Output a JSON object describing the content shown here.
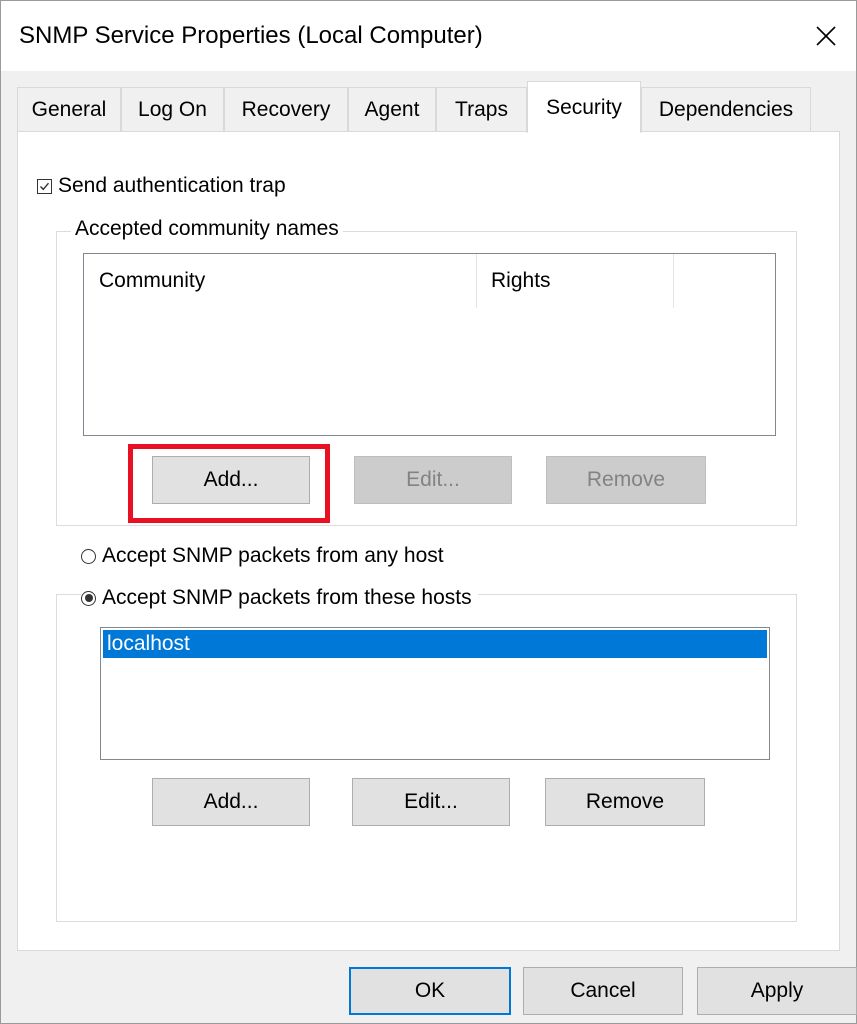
{
  "window": {
    "title": "SNMP Service Properties (Local Computer)"
  },
  "tabs": [
    {
      "label": "General",
      "active": false
    },
    {
      "label": "Log On",
      "active": false
    },
    {
      "label": "Recovery",
      "active": false
    },
    {
      "label": "Agent",
      "active": false
    },
    {
      "label": "Traps",
      "active": false
    },
    {
      "label": "Security",
      "active": true
    },
    {
      "label": "Dependencies",
      "active": false
    }
  ],
  "security": {
    "send_auth_trap": {
      "label": "Send authentication trap",
      "checked": true
    },
    "community_group": {
      "title": "Accepted community names",
      "columns": [
        "Community",
        "Rights"
      ],
      "rows": [],
      "add_label": "Add...",
      "edit_label": "Edit...",
      "remove_label": "Remove",
      "edit_enabled": false,
      "remove_enabled": false
    },
    "accept_any_host": {
      "label": "Accept SNMP packets from any host",
      "selected": false
    },
    "accept_these_hosts": {
      "label": "Accept SNMP packets from these hosts",
      "selected": true
    },
    "hosts_group": {
      "hosts": [
        "localhost"
      ],
      "selected_host": "localhost",
      "add_label": "Add...",
      "edit_label": "Edit...",
      "remove_label": "Remove"
    }
  },
  "footer": {
    "ok_label": "OK",
    "cancel_label": "Cancel",
    "apply_label": "Apply"
  },
  "annotation": {
    "highlight_color": "#e81123",
    "highlighted_control": "Add..."
  },
  "colors": {
    "selection": "#0078d7",
    "dialog_bg": "#f0f0f0"
  }
}
